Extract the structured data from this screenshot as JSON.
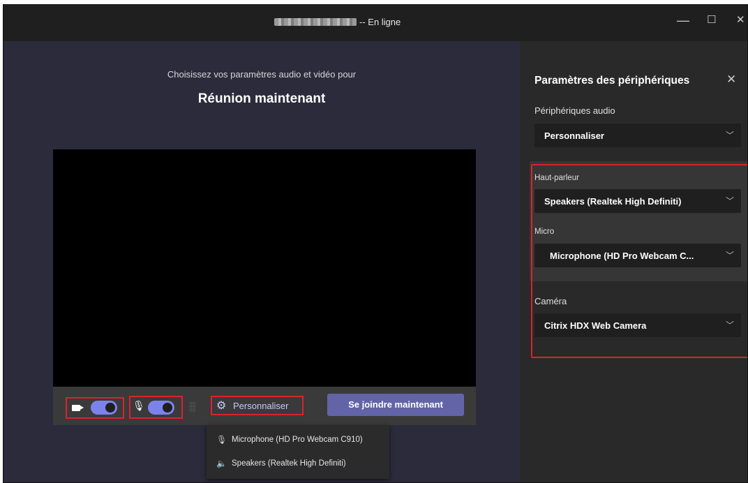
{
  "window": {
    "title_suffix": "-- En ligne",
    "minimize_glyph": "—",
    "maximize_glyph": "☐",
    "close_glyph": "✕"
  },
  "prejoin": {
    "subtitle": "Choisissez vos paramètres audio et vidéo pour",
    "meeting_title": "Réunion maintenant",
    "camera_toggle_on": true,
    "mic_toggle_on": true,
    "personnaliser_label": "Personnaliser",
    "join_label": "Se joindre maintenant",
    "popup": {
      "microphone": "Microphone (HD Pro Webcam C910)",
      "speakers": "Speakers (Realtek High Definiti)"
    }
  },
  "device_panel": {
    "title": "Paramètres des périphériques",
    "audio_devices_label": "Périphériques audio",
    "audio_devices_value": "Personnaliser",
    "speaker_label": "Haut-parleur",
    "speaker_value": "Speakers (Realtek High Definiti)",
    "mic_label": "Micro",
    "mic_value": "Microphone (HD Pro Webcam C...",
    "camera_label": "Caméra",
    "camera_value": "Citrix HDX Web Camera"
  },
  "colors": {
    "accent": "#6264a7",
    "highlight": "#d9232d",
    "toggle_on": "#7b83eb"
  }
}
